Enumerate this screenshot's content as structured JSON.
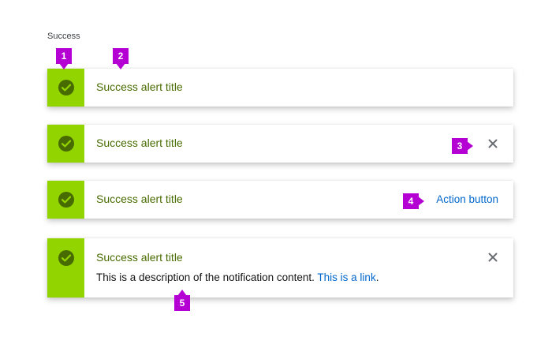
{
  "section": {
    "label": "Success"
  },
  "colors": {
    "success_stripe": "#92d400",
    "success_dark": "#486b00",
    "link": "#0066cc",
    "annotation": "#b500d4"
  },
  "icons": {
    "status": "check-circle-icon",
    "close": "close-icon"
  },
  "alerts": [
    {
      "title": "Success alert title"
    },
    {
      "title": "Success alert title",
      "close": "close"
    },
    {
      "title": "Success alert title",
      "action_label": "Action button"
    },
    {
      "title": "Success alert title",
      "description": "This is a description of the notification content. ",
      "link_text": "This is a link",
      "description_end": ".",
      "close": "close"
    }
  ],
  "callouts": [
    "1",
    "2",
    "3",
    "4",
    "5"
  ]
}
